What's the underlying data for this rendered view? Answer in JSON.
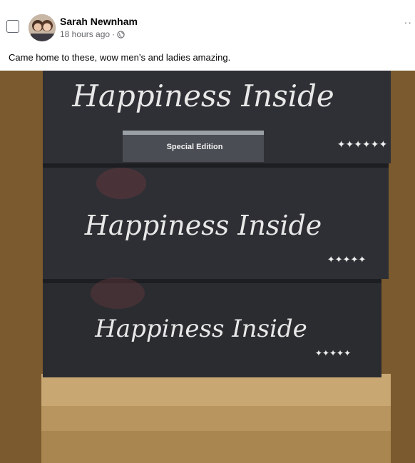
{
  "post": {
    "author": "Sarah Newnham",
    "timestamp": "18 hours ago",
    "separator": "·",
    "caption": "Came home to these, wow men’s and ladies amazing.",
    "more_label": "··"
  },
  "photo": {
    "box_script": "Happiness Inside",
    "label": "Special Edition",
    "stars": "✦✦✦✦✦",
    "stars_top": "✦✦✦✦✦✦"
  },
  "colors": {
    "frame_brown": "#7a5a2e",
    "box_dark": "#2b2c30",
    "table_wood": "#c8a772"
  }
}
